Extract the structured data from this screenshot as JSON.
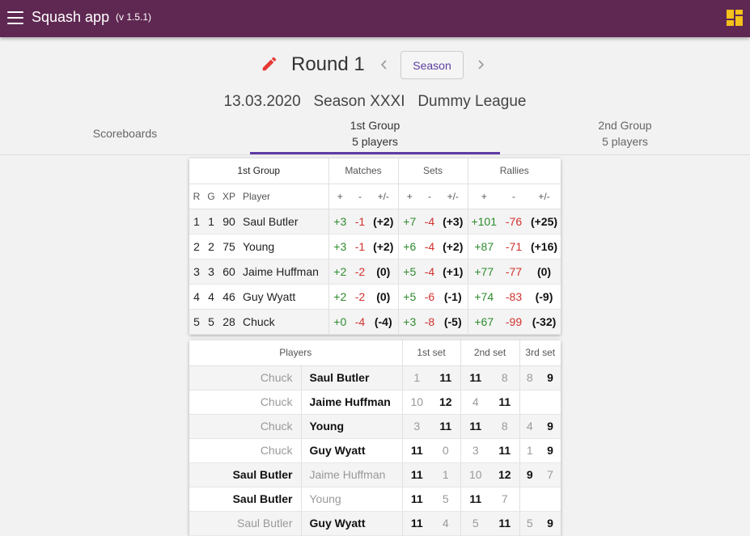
{
  "app": {
    "title": "Squash app",
    "version": "(v 1.5.1)"
  },
  "round": {
    "title": "Round 1",
    "season_button": "Season"
  },
  "subtitle": "13.03.2020   Season XXXI   Dummy League",
  "tabs": [
    {
      "line1": "Scoreboards",
      "line2": ""
    },
    {
      "line1": "1st Group",
      "line2": "5 players"
    },
    {
      "line1": "2nd Group",
      "line2": "5 players"
    }
  ],
  "standings": {
    "group_header": "1st Group",
    "section_headers": [
      "Matches",
      "Sets",
      "Rallies"
    ],
    "col_headers": [
      "R",
      "G",
      "XP",
      "Player",
      "+",
      "-",
      "+/-",
      "+",
      "-",
      "+/-",
      "+",
      "-",
      "+/-"
    ],
    "rows": [
      {
        "r": "1",
        "g": "1",
        "xp": "90",
        "player": "Saul Butler",
        "mp": "+3",
        "mm": "-1",
        "md": "(+2)",
        "sp": "+7",
        "sm": "-4",
        "sd": "(+3)",
        "rp": "+101",
        "rm": "-76",
        "rd": "(+25)"
      },
      {
        "r": "2",
        "g": "2",
        "xp": "75",
        "player": "Young",
        "mp": "+3",
        "mm": "-1",
        "md": "(+2)",
        "sp": "+6",
        "sm": "-4",
        "sd": "(+2)",
        "rp": "+87",
        "rm": "-71",
        "rd": "(+16)"
      },
      {
        "r": "3",
        "g": "3",
        "xp": "60",
        "player": "Jaime Huffman",
        "mp": "+2",
        "mm": "-2",
        "md": "(0)",
        "sp": "+5",
        "sm": "-4",
        "sd": "(+1)",
        "rp": "+77",
        "rm": "-77",
        "rd": "(0)"
      },
      {
        "r": "4",
        "g": "4",
        "xp": "46",
        "player": "Guy Wyatt",
        "mp": "+2",
        "mm": "-2",
        "md": "(0)",
        "sp": "+5",
        "sm": "-6",
        "sd": "(-1)",
        "rp": "+74",
        "rm": "-83",
        "rd": "(-9)"
      },
      {
        "r": "5",
        "g": "5",
        "xp": "28",
        "player": "Chuck",
        "mp": "+0",
        "mm": "-4",
        "md": "(-4)",
        "sp": "+3",
        "sm": "-8",
        "sd": "(-5)",
        "rp": "+67",
        "rm": "-99",
        "rd": "(-32)"
      }
    ]
  },
  "matches": {
    "headers": [
      "Players",
      "1st set",
      "2nd set",
      "3rd set"
    ],
    "rows": [
      {
        "p1": "Chuck",
        "p2": "Saul Butler",
        "winner": 2,
        "s1": [
          "1",
          "11"
        ],
        "s2": [
          "11",
          "8"
        ],
        "s3": [
          "8",
          "9"
        ]
      },
      {
        "p1": "Chuck",
        "p2": "Jaime Huffman",
        "winner": 2,
        "s1": [
          "10",
          "12"
        ],
        "s2": [
          "4",
          "11"
        ],
        "s3": [
          "",
          ""
        ]
      },
      {
        "p1": "Chuck",
        "p2": "Young",
        "winner": 2,
        "s1": [
          "3",
          "11"
        ],
        "s2": [
          "11",
          "8"
        ],
        "s3": [
          "4",
          "9"
        ]
      },
      {
        "p1": "Chuck",
        "p2": "Guy Wyatt",
        "winner": 2,
        "s1": [
          "11",
          "0"
        ],
        "s2": [
          "3",
          "11"
        ],
        "s3": [
          "1",
          "9"
        ]
      },
      {
        "p1": "Saul Butler",
        "p2": "Jaime Huffman",
        "winner": 1,
        "s1": [
          "11",
          "1"
        ],
        "s2": [
          "10",
          "12"
        ],
        "s3": [
          "9",
          "7"
        ]
      },
      {
        "p1": "Saul Butler",
        "p2": "Young",
        "winner": 1,
        "s1": [
          "11",
          "5"
        ],
        "s2": [
          "11",
          "7"
        ],
        "s3": [
          "",
          ""
        ]
      },
      {
        "p1": "Saul Butler",
        "p2": "Guy Wyatt",
        "winner": 2,
        "s1": [
          "11",
          "4"
        ],
        "s2": [
          "5",
          "11"
        ],
        "s3": [
          "5",
          "9"
        ]
      }
    ]
  }
}
